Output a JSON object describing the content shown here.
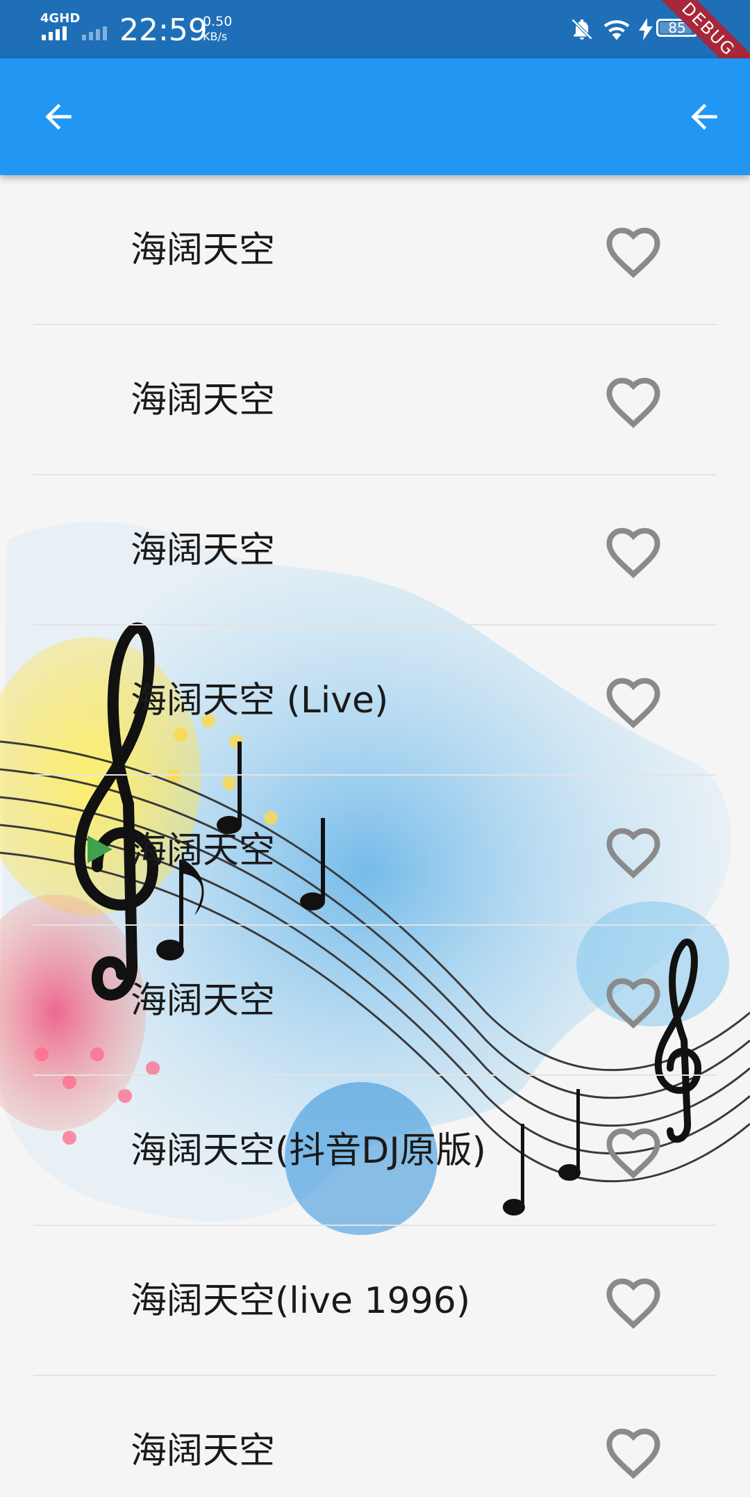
{
  "status_bar": {
    "network": "4GHD",
    "time": "22:59",
    "speed_value": "0.50",
    "speed_unit": "KB/s",
    "battery": "85",
    "debug_label": "DEBUG"
  },
  "app_bar": {
    "left_icon": "arrow-left-icon",
    "right_icon": "arrow-left-icon",
    "background_color": "#2196f3"
  },
  "songs": [
    {
      "title": "海阔天空",
      "favorite": false
    },
    {
      "title": "海阔天空",
      "favorite": false
    },
    {
      "title": "海阔天空",
      "favorite": false
    },
    {
      "title": "海阔天空 (Live)",
      "favorite": false
    },
    {
      "title": "海阔天空",
      "favorite": false,
      "playing": true
    },
    {
      "title": "海阔天空",
      "favorite": false
    },
    {
      "title": "海阔天空(抖音DJ原版)",
      "favorite": false
    },
    {
      "title": "海阔天空(live 1996)",
      "favorite": false
    },
    {
      "title": "海阔天空",
      "favorite": false
    }
  ],
  "colors": {
    "accent": "#2196f3",
    "heart": "#8a8a8a",
    "playing_indicator": "#3fa34d"
  }
}
